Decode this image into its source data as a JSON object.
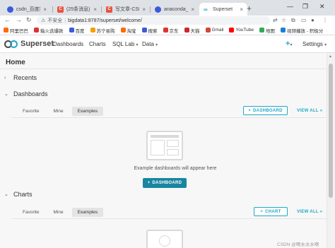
{
  "browser": {
    "tabs": [
      {
        "title": "csdn_百度搜索",
        "favicon": "paw-icon"
      },
      {
        "title": "(25条消息) CSD",
        "favicon": "csdn-icon"
      },
      {
        "title": "写文章-CSDN博",
        "favicon": "csdn-icon"
      },
      {
        "title": "anaconda_百度",
        "favicon": "paw-icon"
      },
      {
        "title": "Superset",
        "favicon": "superset-icon",
        "active": true
      }
    ],
    "new_tab": "+",
    "address": {
      "security_label": "不安全",
      "url": "bigdata1:8787/superset/welcome/"
    },
    "bookmarks": [
      "阿里巴巴",
      "箱火迭爆款",
      "百度",
      "苏宁易购",
      "淘宝",
      "搜索",
      "京东",
      "天猫",
      "Gmail",
      "YouTube",
      "地图",
      "视频播放 - 积极分"
    ]
  },
  "navbar": {
    "brand": "Superset",
    "menu": [
      "Dashboards",
      "Charts",
      "SQL Lab",
      "Data"
    ],
    "plus": "+",
    "settings": "Settings"
  },
  "page": {
    "title": "Home",
    "sections": {
      "recents": "Recents",
      "dashboards": "Dashboards",
      "charts": "Charts"
    },
    "dashboard_tabs": [
      "Favorite",
      "Mine",
      "Examples"
    ],
    "chart_tabs": [
      "Favorite",
      "Mine",
      "Examples"
    ],
    "dashboard_add_label": "DASHBOARD",
    "chart_add_label": "CHART",
    "view_all": "VIEW ALL »",
    "empty_dashboards_text": "Example dashboards will appear here",
    "empty_dashboard_button": "DASHBOARD"
  },
  "watermark": "CSDN @啊水水水啊"
}
